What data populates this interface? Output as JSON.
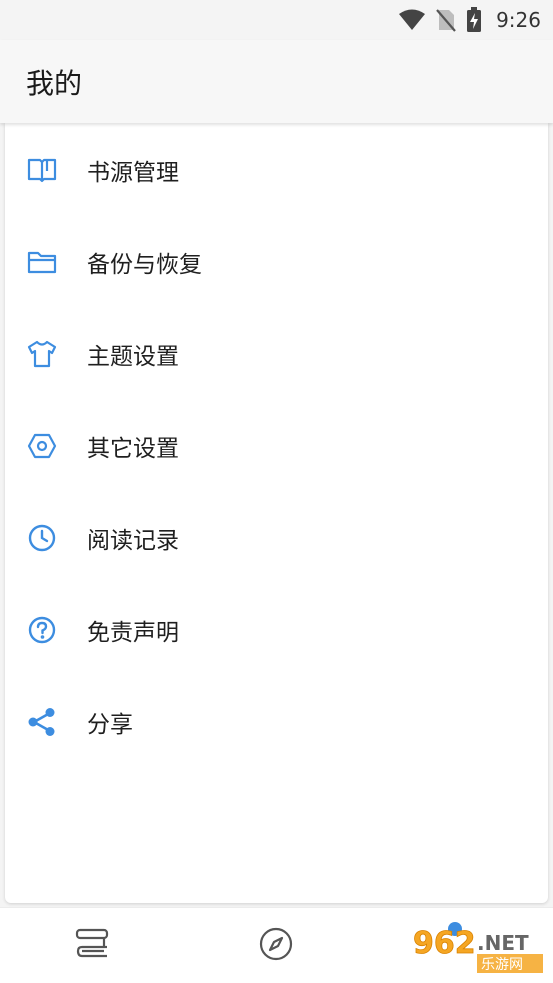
{
  "status_bar": {
    "time": "9:26"
  },
  "app_bar": {
    "title": "我的"
  },
  "menu": {
    "items": [
      {
        "label": "书源管理",
        "icon": "book-open-icon"
      },
      {
        "label": "备份与恢复",
        "icon": "folder-icon"
      },
      {
        "label": "主题设置",
        "icon": "tshirt-icon"
      },
      {
        "label": "其它设置",
        "icon": "hexagon-settings-icon"
      },
      {
        "label": "阅读记录",
        "icon": "clock-icon"
      },
      {
        "label": "免责声明",
        "icon": "help-circle-icon"
      },
      {
        "label": "分享",
        "icon": "share-icon"
      }
    ]
  },
  "bottom_nav": {
    "items": [
      {
        "icon": "bookshelf-icon"
      },
      {
        "icon": "compass-icon"
      },
      {
        "icon": "profile-icon"
      }
    ]
  },
  "watermark": {
    "text_top": "962",
    "text_net": ".NET",
    "text_bottom": "乐游网"
  },
  "colors": {
    "accent": "#3d8de0",
    "background": "#f4f4f4",
    "card": "#ffffff",
    "text": "#1f1f1f"
  }
}
